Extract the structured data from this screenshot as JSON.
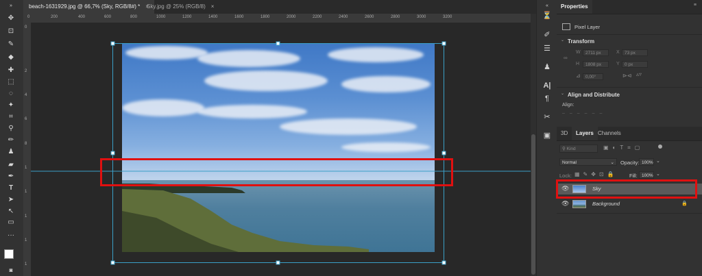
{
  "tabs": [
    {
      "label": "beach-1631929.jpg @ 66,7% (Sky, RGB/8#) *",
      "close": "×"
    },
    {
      "label": "Sky.jpg @ 25% (RGB/8)",
      "close": "×"
    }
  ],
  "ruler": {
    "top": [
      "0",
      "200",
      "400",
      "600",
      "800",
      "1000",
      "1200",
      "1400",
      "1600",
      "1800",
      "2000",
      "2200",
      "2400",
      "2600",
      "2800",
      "3000",
      "3200"
    ],
    "left": [
      "0",
      "2",
      "4",
      "6",
      "8",
      "1",
      "1",
      "1",
      "1",
      "1"
    ]
  },
  "properties": {
    "tab": "Properties",
    "kind": "Pixel Layer",
    "transform": {
      "title": "Transform",
      "w_label": "W",
      "w_value": "2711 px",
      "x_label": "X",
      "x_value": "73 px",
      "h_label": "H",
      "h_value": "1808 px",
      "y_label": "Y",
      "y_value": "0 px",
      "angle_value": "0,00°"
    },
    "align": {
      "title": "Align and Distribute",
      "align_label": "Align:"
    }
  },
  "layers_panel": {
    "tabs": [
      "3D",
      "Layers",
      "Channels"
    ],
    "active_tab": "Layers",
    "kind_placeholder": "Kind",
    "blend_mode": "Normal",
    "opacity_label": "Opacity:",
    "opacity_value": "100%",
    "lock_label": "Lock:",
    "fill_label": "Fill:",
    "fill_value": "100%",
    "layers": [
      {
        "name": "Sky",
        "selected": true
      },
      {
        "name": "Background",
        "selected": false
      }
    ]
  },
  "colors": {
    "highlight": "#e01010",
    "guide": "#3ba0c8",
    "selected_layer": "#5a5a5a"
  }
}
